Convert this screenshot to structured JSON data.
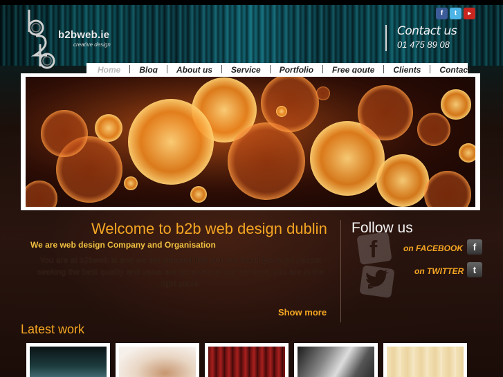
{
  "brand": {
    "name": "b2bweb.ie",
    "tagline": "creative design",
    "accent_color": "#f5a623"
  },
  "header": {
    "contact_title": "Contact us",
    "phone": "01 475 89 08",
    "social_icons": [
      "facebook-icon",
      "twitter-icon",
      "youtube-icon"
    ]
  },
  "nav": {
    "items": [
      {
        "label": "Home",
        "active": true
      },
      {
        "label": "Blog"
      },
      {
        "label": "About us"
      },
      {
        "label": "Service"
      },
      {
        "label": "Portfolio"
      },
      {
        "label": "Free qoute"
      },
      {
        "label": "Clients"
      },
      {
        "label": "Contact"
      }
    ]
  },
  "welcome": {
    "title": "Welcome to b2b web design dublin",
    "subtitle": "We are web design Company and Organisation",
    "body": "You are at b2bweb.ie and we are pleased that you are here! Because people seeking the best quality and value are receivers of our services, you are in the right place.",
    "show_more": "Show more"
  },
  "follow": {
    "title": "Follow us",
    "facebook_label": "on FACEBOOK",
    "twitter_label": "on TWITTER"
  },
  "latest": {
    "title": "Latest work",
    "thumbnails": [
      "thumb-dark-photo",
      "thumb-portrait",
      "thumb-red-stage",
      "thumb-bw-photo",
      "thumb-cream-texture"
    ]
  }
}
